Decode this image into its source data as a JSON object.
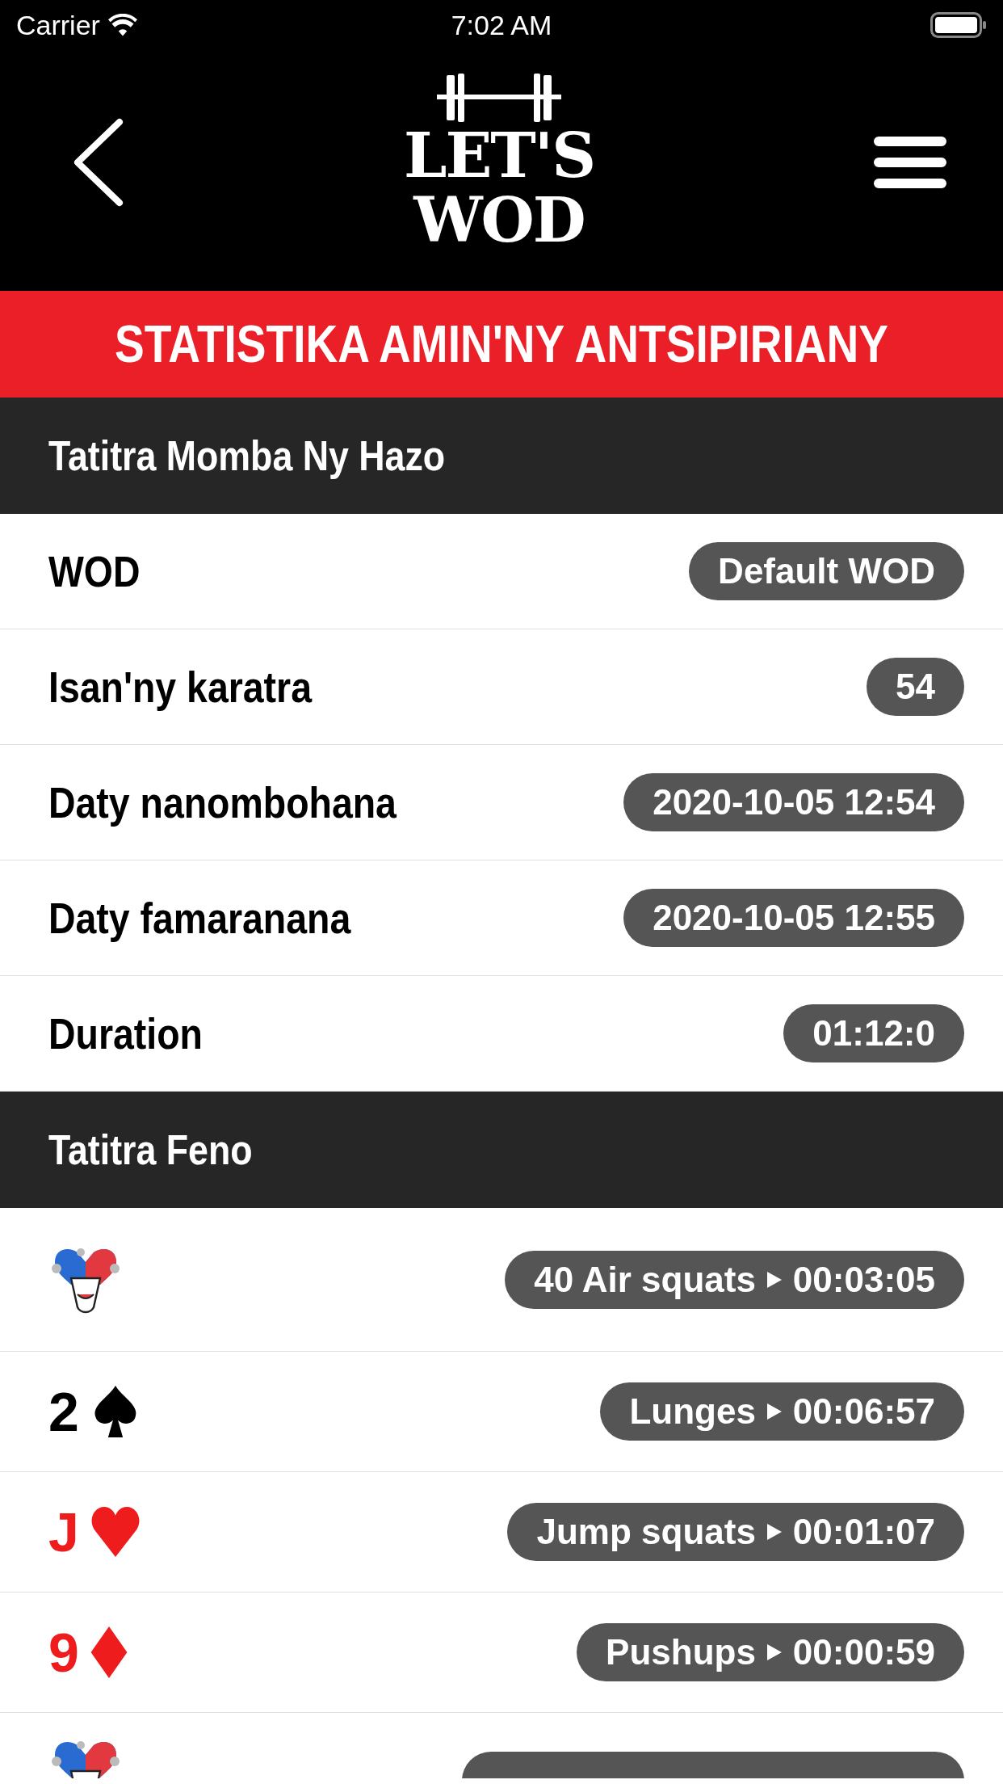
{
  "status_bar": {
    "carrier": "Carrier",
    "time": "7:02 AM"
  },
  "nav": {
    "logo": [
      "LET'S",
      "WOD"
    ]
  },
  "banner": "STATISTIKA AMIN'NY ANTSIPIRIANY",
  "sections": [
    {
      "title": "Tatitra Momba Ny Hazo",
      "kind": "stats",
      "rows": [
        {
          "label": "WOD",
          "value": "Default WOD"
        },
        {
          "label": "Isan'ny karatra",
          "value": "54"
        },
        {
          "label": "Daty nanombohana",
          "value": "2020-10-05 12:54"
        },
        {
          "label": "Daty famaranana",
          "value": "2020-10-05 12:55"
        },
        {
          "label": "Duration",
          "value": "01:12:0"
        }
      ]
    },
    {
      "title": "Tatitra Feno",
      "kind": "cards",
      "rows": [
        {
          "kind": "joker",
          "exercise": "40 Air squats",
          "time": "00:03:05"
        },
        {
          "kind": "spades",
          "rank": "2",
          "color": "#000000",
          "exercise": "Lunges",
          "time": "00:06:57"
        },
        {
          "kind": "hearts",
          "rank": "J",
          "color": "#ee1c1c",
          "exercise": "Jump squats",
          "time": "00:01:07"
        },
        {
          "kind": "diamonds",
          "rank": "9",
          "color": "#ee1c1c",
          "exercise": "Pushups",
          "time": "00:00:59"
        },
        {
          "kind": "joker",
          "cut": true
        }
      ]
    }
  ]
}
